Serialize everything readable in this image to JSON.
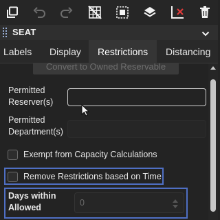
{
  "toolbar": {
    "icons": [
      "copy-icon",
      "undo-icon",
      "redo-icon",
      "grid-off-icon",
      "select-region-icon",
      "layers-icon",
      "clear-axis-icon",
      "delete-icon"
    ]
  },
  "panel": {
    "title": "SEAT"
  },
  "tabs": [
    {
      "label": "Labels",
      "active": false
    },
    {
      "label": "Display",
      "active": false
    },
    {
      "label": "Restrictions",
      "active": true
    },
    {
      "label": "Distancing",
      "active": false
    }
  ],
  "restrictions": {
    "convert_button": "Convert to Owned Reservable",
    "permitted_reserver_label_line1": "Permitted",
    "permitted_reserver_label_line2": "Reserver(s)",
    "permitted_reserver_value": "",
    "permitted_department_label_line1": "Permitted",
    "permitted_department_label_line2": "Department(s)",
    "permitted_department_value": "",
    "exempt_label": "Exempt from Capacity Calculations",
    "exempt_checked": false,
    "remove_restrictions_label": "Remove Restrictions based on Time",
    "remove_restrictions_checked": false,
    "days_within_label_line1": "Days within",
    "days_within_label_line2": "Allowed",
    "days_within_value": "0"
  },
  "colors": {
    "highlight": "#4f6fc4",
    "accent_red": "#e03a3a"
  }
}
